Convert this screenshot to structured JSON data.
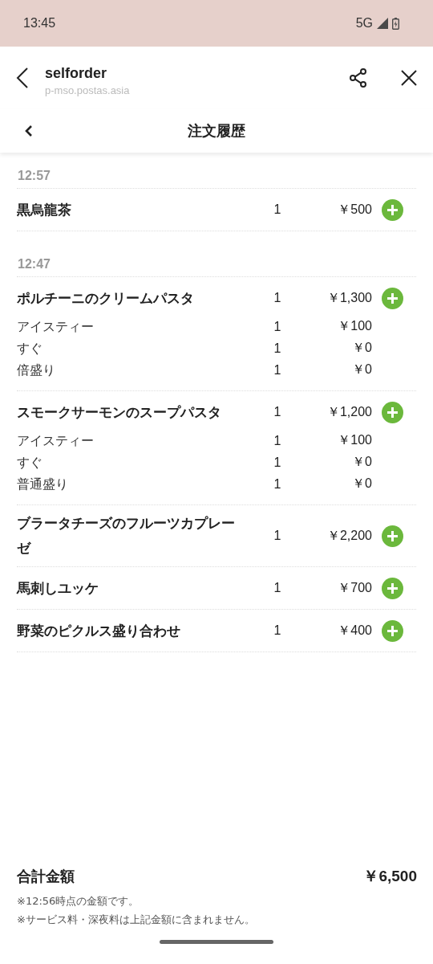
{
  "status_bar": {
    "time": "13:45",
    "network": "5G"
  },
  "browser": {
    "title": "selforder",
    "url": "p-mso.postas.asia"
  },
  "page": {
    "title": "注文履歴"
  },
  "groups": [
    {
      "time": "12:57",
      "items": [
        {
          "name": "黒烏龍茶",
          "qty": "1",
          "price": "￥500"
        }
      ]
    },
    {
      "time": "12:47",
      "items": [
        {
          "name": "ポルチーニのクリームパスタ",
          "qty": "1",
          "price": "￥1,300",
          "options": [
            {
              "name": "アイスティー",
              "qty": "1",
              "price": "￥100"
            },
            {
              "name": "すぐ",
              "qty": "1",
              "price": "￥0"
            },
            {
              "name": "倍盛り",
              "qty": "1",
              "price": "￥0"
            }
          ]
        },
        {
          "name": "スモークサーモンのスープパスタ",
          "qty": "1",
          "price": "￥1,200",
          "options": [
            {
              "name": "アイスティー",
              "qty": "1",
              "price": "￥100"
            },
            {
              "name": "すぐ",
              "qty": "1",
              "price": "￥0"
            },
            {
              "name": "普通盛り",
              "qty": "1",
              "price": "￥0"
            }
          ]
        },
        {
          "name": "ブラータチーズのフルーツカプレーゼ",
          "qty": "1",
          "price": "￥2,200"
        },
        {
          "name": "馬刺しユッケ",
          "qty": "1",
          "price": "￥700"
        },
        {
          "name": "野菜のピクルス盛り合わせ",
          "qty": "1",
          "price": "￥400"
        }
      ]
    }
  ],
  "total": {
    "label": "合計金額",
    "amount": "￥6,500",
    "notes": [
      "※12:56時点の金額です。",
      "※サービス料・深夜料は上記金額に含まれません。"
    ]
  }
}
